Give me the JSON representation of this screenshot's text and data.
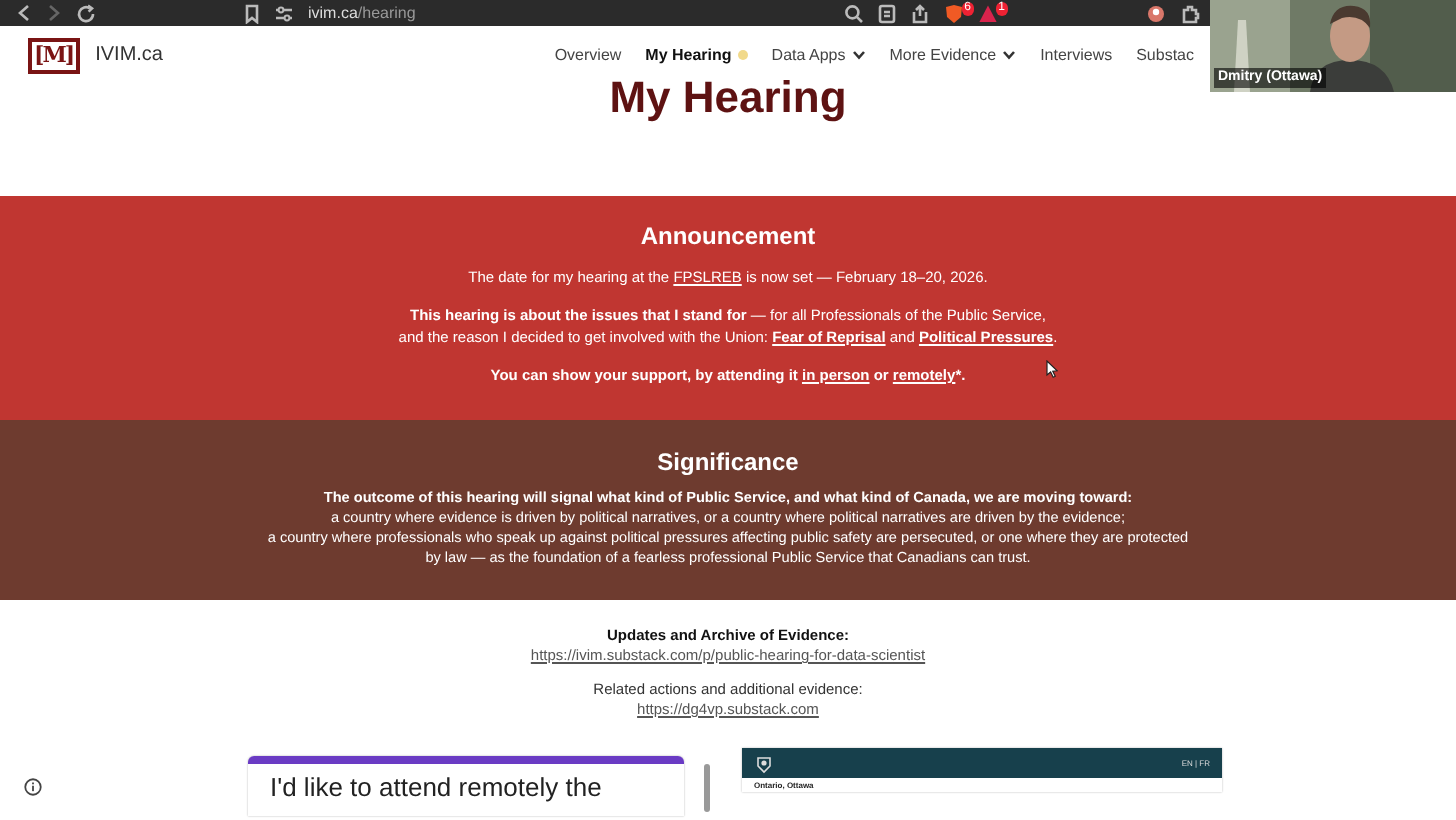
{
  "browser": {
    "url_host": "ivim.ca",
    "url_path": "/hearing",
    "badges": [
      {
        "kind": "shield",
        "count": "6"
      },
      {
        "kind": "alert",
        "count": "1"
      }
    ]
  },
  "site": {
    "name": "IVIM.ca",
    "logo": "[M]",
    "nav": [
      {
        "label": "Overview",
        "selected": false,
        "dropdown": false
      },
      {
        "label": "My Hearing",
        "selected": true,
        "dropdown": false
      },
      {
        "label": "Data Apps",
        "selected": false,
        "dropdown": true
      },
      {
        "label": "More Evidence",
        "selected": false,
        "dropdown": true
      },
      {
        "label": "Interviews",
        "selected": false,
        "dropdown": false
      },
      {
        "label": "Substac",
        "selected": false,
        "dropdown": false
      }
    ]
  },
  "video": {
    "caption": "Dmitry (Ottawa)"
  },
  "page_title": "My Hearing",
  "announcement": {
    "heading": "Announcement",
    "paragraphs": [
      [
        {
          "kind": "text",
          "text": "The date for my hearing at the "
        },
        {
          "kind": "link",
          "text": "FPSLREB",
          "bold": false
        },
        {
          "kind": "text",
          "text": " is now set — February 18–20, 2026."
        }
      ],
      [
        {
          "kind": "bold",
          "text": "This hearing is about the issues that I stand for"
        },
        {
          "kind": "text",
          "text": " — for all Professionals of the Public Service,"
        },
        {
          "kind": "break"
        },
        {
          "kind": "text",
          "text": "and the reason I decided to get involved with the Union: "
        },
        {
          "kind": "link",
          "text": "Fear of Reprisal",
          "bold": true
        },
        {
          "kind": "text",
          "text": " and "
        },
        {
          "kind": "link",
          "text": "Political Pressures",
          "bold": true
        },
        {
          "kind": "text",
          "text": "."
        }
      ],
      [
        {
          "kind": "bold",
          "text": "You can show your support, by attending it "
        },
        {
          "kind": "link",
          "text": "in person",
          "bold": true
        },
        {
          "kind": "bold",
          "text": " or "
        },
        {
          "kind": "link",
          "text": "remotely",
          "bold": true
        },
        {
          "kind": "bold",
          "text": "*."
        }
      ]
    ]
  },
  "significance": {
    "heading": "Significance",
    "lead": "The outcome of this hearing will signal what kind of Public Service, and what kind of Canada, we are moving toward:",
    "lines": [
      "a country where evidence is driven by political narratives, or a country where political narratives are driven by the evidence;",
      "a country where professionals who speak up against political pressures affecting public safety are persecuted, or one where they are protected",
      "by law — as the foundation of a fearless professional Public Service that Canadians can trust."
    ]
  },
  "links": [
    {
      "label": "Updates and Archive of Evidence:",
      "bold": true,
      "url": "https://ivim.substack.com/p/public-hearing-for-data-scientist"
    },
    {
      "label": "Related actions  and  additional evidence:",
      "bold": false,
      "url": "https://dg4vp.substack.com"
    }
  ],
  "form_card": {
    "title": "I'd like to attend remotely the"
  },
  "embed": {
    "languages": "EN | FR",
    "location": "Ontario, Ottawa"
  }
}
